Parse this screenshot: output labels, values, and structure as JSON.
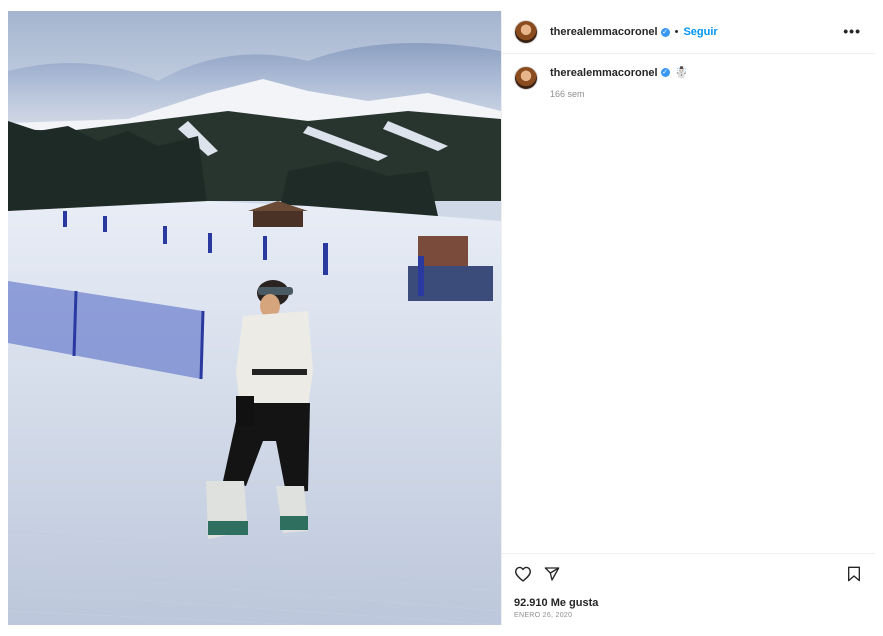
{
  "post": {
    "username": "therealemmacoronel",
    "separator": "•",
    "follow_label": "Seguir",
    "more_label": "•••",
    "caption_emoji": "☃️",
    "time_ago": "166 sem",
    "likes": "92.910 Me gusta",
    "date": "ENERO 26, 2020"
  },
  "icons": {
    "verified": "✓",
    "like": "heart-icon",
    "share": "send-icon",
    "save": "bookmark-icon"
  },
  "colors": {
    "accent": "#0095f6",
    "verified": "#3897f0",
    "muted": "#8e8e8e"
  }
}
